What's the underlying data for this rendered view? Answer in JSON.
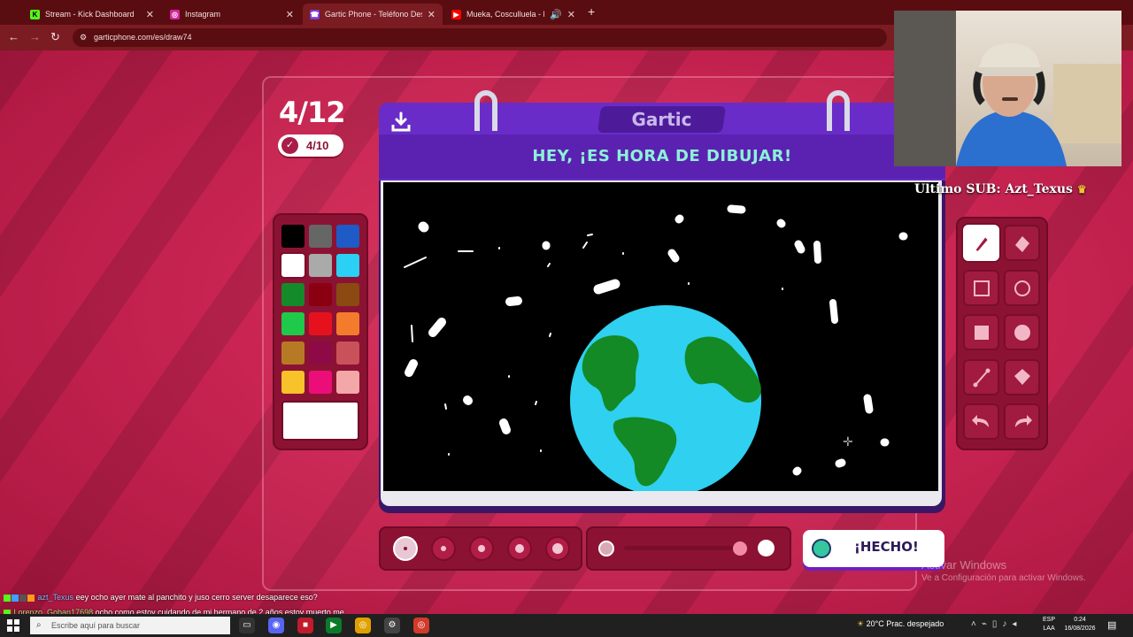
{
  "browser": {
    "tabs": [
      {
        "title": "Stream - Kick Dashboard",
        "favicon": "kick-icon",
        "active": false
      },
      {
        "title": "Instagram",
        "favicon": "instagram-icon",
        "active": false
      },
      {
        "title": "Gartic Phone - Teléfono Desco...",
        "favicon": "gartic-icon",
        "active": true
      },
      {
        "title": "Mueka, Cosculluela - DM (V...",
        "favicon": "youtube-icon",
        "active": false
      }
    ],
    "url": "garticphone.com/es/draw74"
  },
  "game": {
    "round": "4/12",
    "done_count": "4/10",
    "logo": "Gartic",
    "banner": "HEY, ¡ES HORA DE DIBUJAR!",
    "done_button": "¡HECHO!",
    "selected_color": "#ffffff",
    "palette": [
      "#000000",
      "#666666",
      "#1e5bc6",
      "#ffffff",
      "#aaaaaa",
      "#2ad1f5",
      "#158a2a",
      "#8a0010",
      "#8a4a12",
      "#1fc94a",
      "#e5121e",
      "#f47b2b",
      "#b77a24",
      "#8e0a46",
      "#c9515a",
      "#f7c22a",
      "#ec0e78",
      "#f4a7a7"
    ],
    "tools": [
      "pencil-icon",
      "eraser-icon",
      "square-outline-icon",
      "circle-outline-icon",
      "square-filled-icon",
      "circle-filled-icon",
      "line-icon",
      "fill-bucket-icon",
      "undo-icon",
      "redo-icon"
    ],
    "brush_sizes": [
      1,
      2,
      3,
      4,
      5
    ],
    "selected_brush_size": 1,
    "opacity": 1
  },
  "overlay": {
    "last_sub_label": "Ultimo SUB: Azt_Texus",
    "watermark_title": "Activar Windows",
    "watermark_sub": "Ve a Configuración para activar Windows."
  },
  "chat": [
    {
      "user": "azt_Texus",
      "message": "eey ocho ayer mate al panchito y juso cerro server desaparece eso?"
    },
    {
      "user": "Lorenzo_Goban17698",
      "message": "ocho como estoy cuidando de mi hermano de 2 años estoy muerto me"
    },
    {
      "user": "",
      "message": "enal"
    }
  ],
  "taskbar": {
    "search_placeholder": "Escribe aquí para buscar",
    "weather": "20°C  Prac. despejado",
    "lang_top": "ESP",
    "lang_bottom": "LAA",
    "time": "0:24",
    "date": "16/08/2026"
  }
}
